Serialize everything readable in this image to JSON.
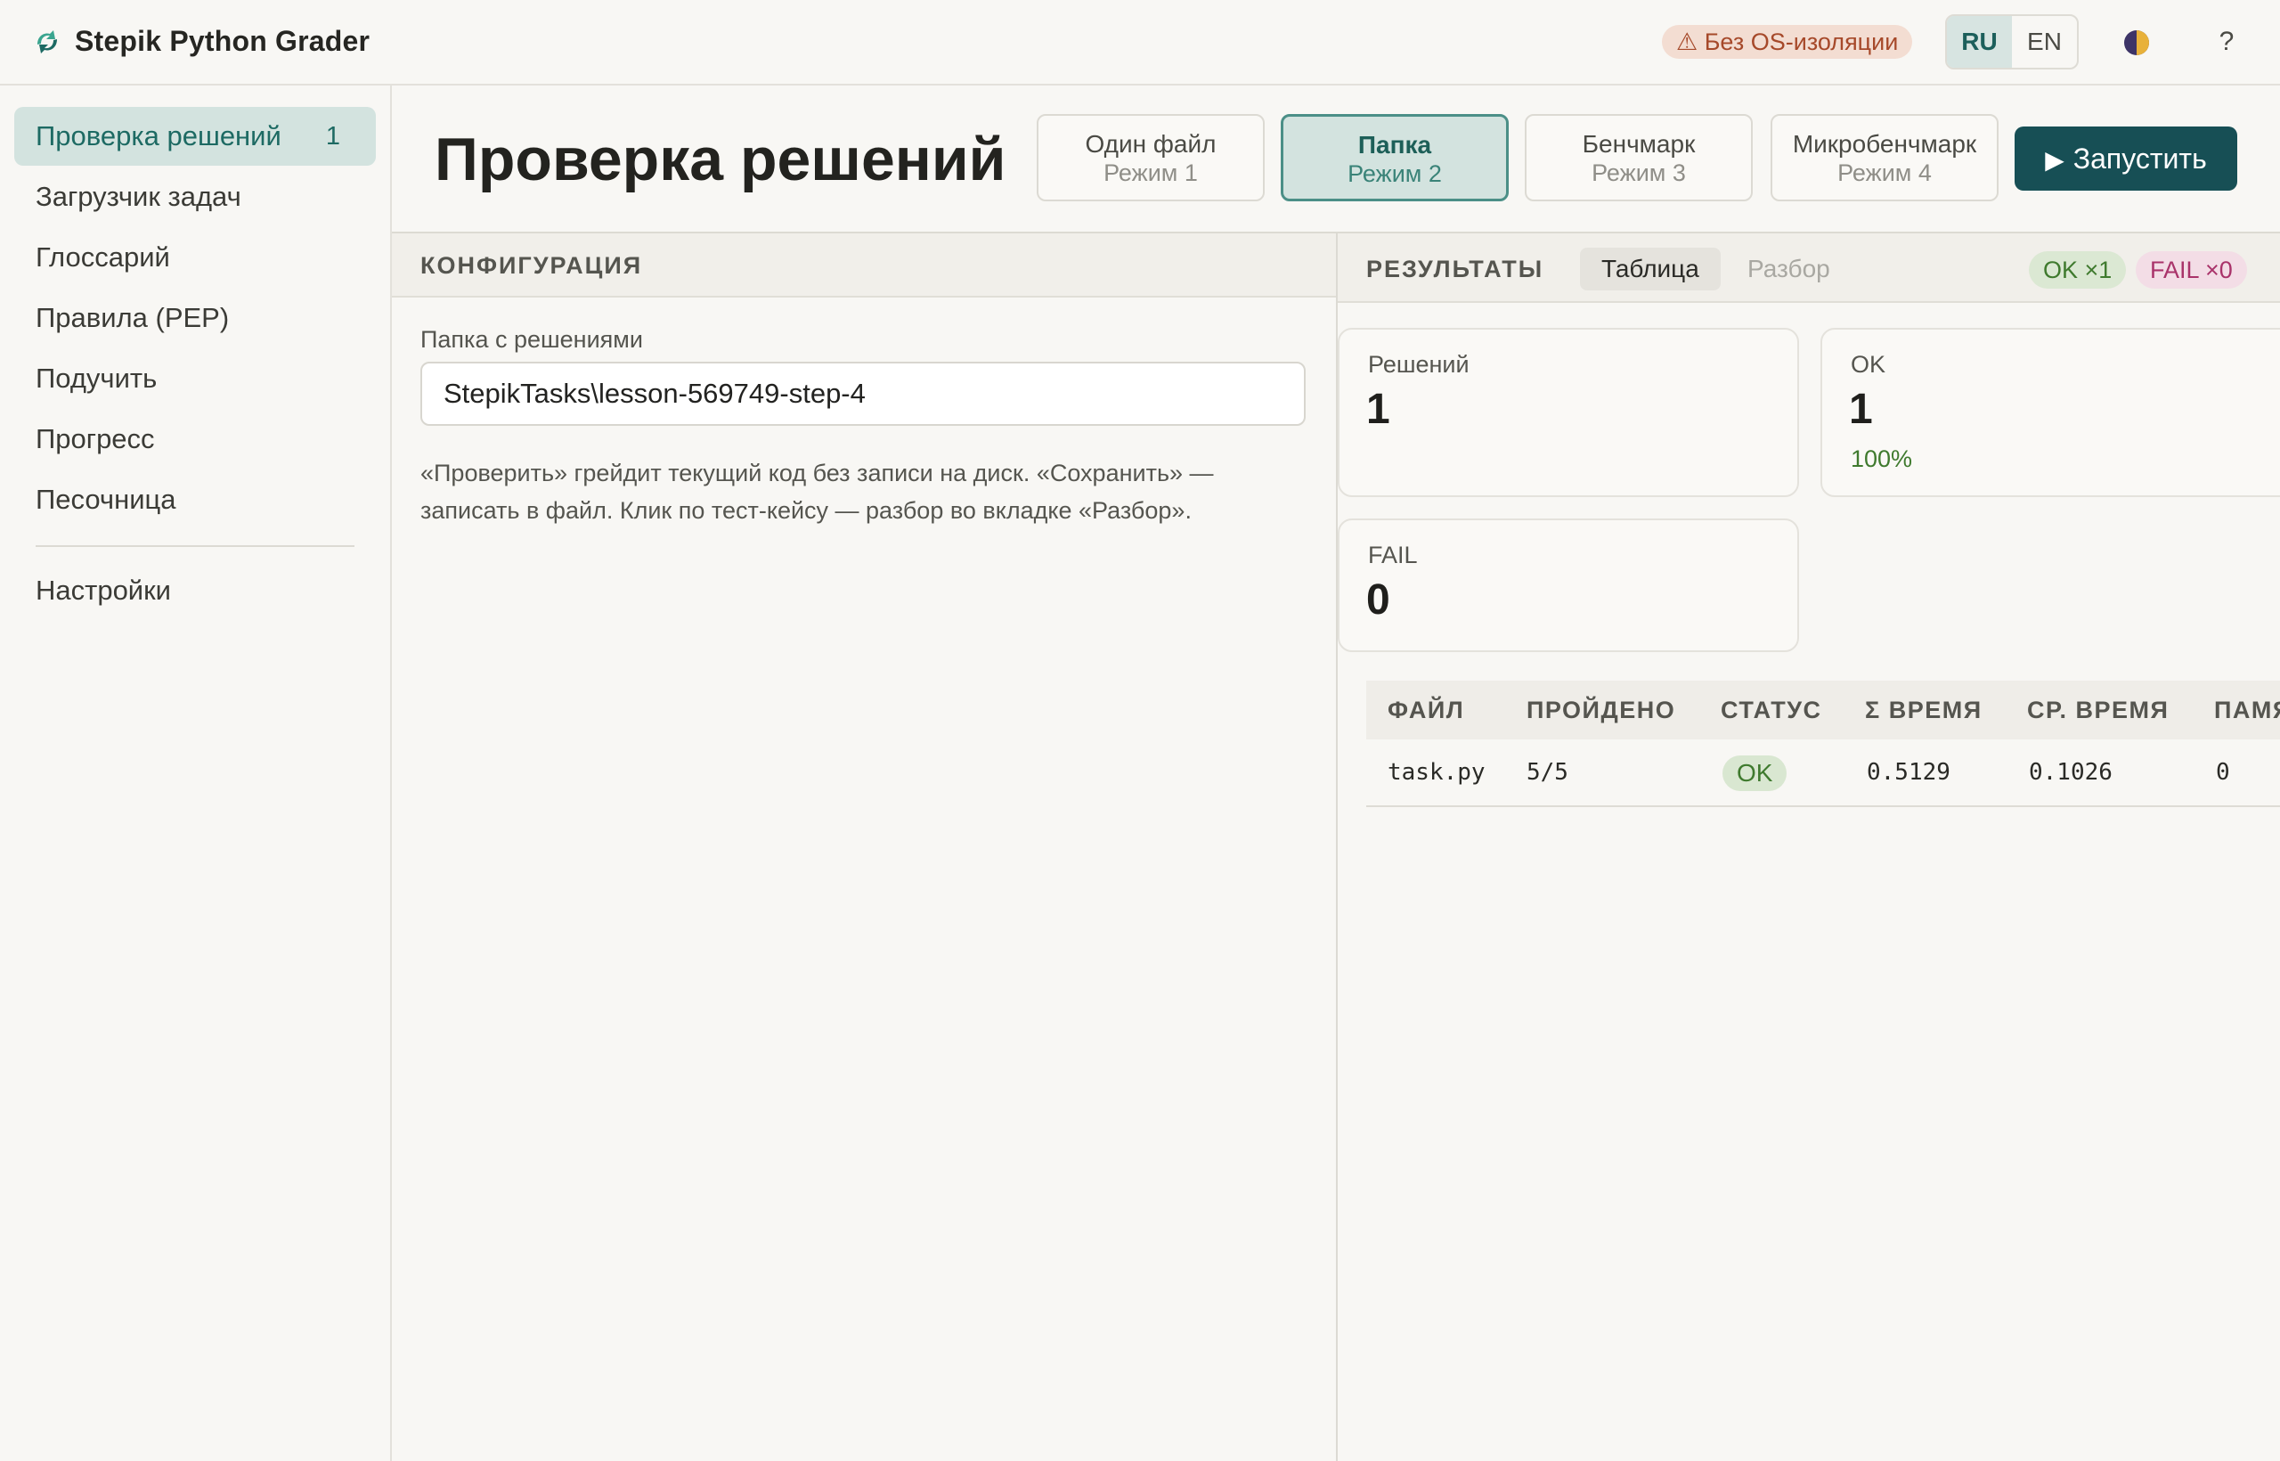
{
  "app": {
    "name": "Stepik Python Grader",
    "warning_badge": "⚠ Без OS-изоляции",
    "languages": [
      "RU",
      "EN"
    ],
    "active_language": "RU",
    "help_label": "?"
  },
  "sidebar": {
    "items": [
      {
        "label": "Проверка решений",
        "count": "1",
        "active": true
      },
      {
        "label": "Загрузчик задач"
      },
      {
        "label": "Глоссарий"
      },
      {
        "label": "Правила (PEP)"
      },
      {
        "label": "Подучить"
      },
      {
        "label": "Прогресс"
      },
      {
        "label": "Песочница"
      }
    ],
    "footer_item": "Настройки"
  },
  "header": {
    "title": "Проверка решений",
    "modes": [
      {
        "title": "Один файл",
        "sub": "Режим 1"
      },
      {
        "title": "Папка",
        "sub": "Режим 2",
        "active": true
      },
      {
        "title": "Бенчмарк",
        "sub": "Режим 3"
      },
      {
        "title": "Микробенчмарк",
        "sub": "Режим 4"
      }
    ],
    "run_label": "Запустить"
  },
  "config": {
    "title": "КОНФИГУРАЦИЯ",
    "folder_label": "Папка с решениями",
    "folder_value": "StepikTasks\\lesson-569749-step-4",
    "help_text": "«Проверить» грейдит текущий код без записи на диск. «Сохранить» — записать в файл. Клик по тест-кейсу — разбор во вкладке «Разбор»."
  },
  "results": {
    "title": "РЕЗУЛЬТАТЫ",
    "tabs": [
      "Таблица",
      "Разбор"
    ],
    "active_tab": "Таблица",
    "ok_pill": "OK ×1",
    "fail_pill": "FAIL ×0",
    "stats": {
      "solutions": {
        "label": "Решений",
        "value": "1"
      },
      "ok": {
        "label": "OK",
        "value": "1",
        "pct": "100%"
      },
      "fail": {
        "label": "FAIL",
        "value": "0"
      }
    },
    "columns": [
      "ФАЙЛ",
      "ПРОЙДЕНО",
      "СТАТУС",
      "Σ ВРЕМЯ",
      "СР. ВРЕМЯ",
      "ПАМЯТЬ"
    ],
    "rows": [
      {
        "file": "task.py",
        "passed": "5/5",
        "status": "OK",
        "total_time": "0.5129",
        "avg_time": "0.1026",
        "memory": "0"
      }
    ]
  },
  "colors": {
    "accent": "#174f55",
    "active_bg": "#d3e3df",
    "ok": "#3f7a2e",
    "fail": "#a9336a",
    "warning": "#a6492a"
  }
}
